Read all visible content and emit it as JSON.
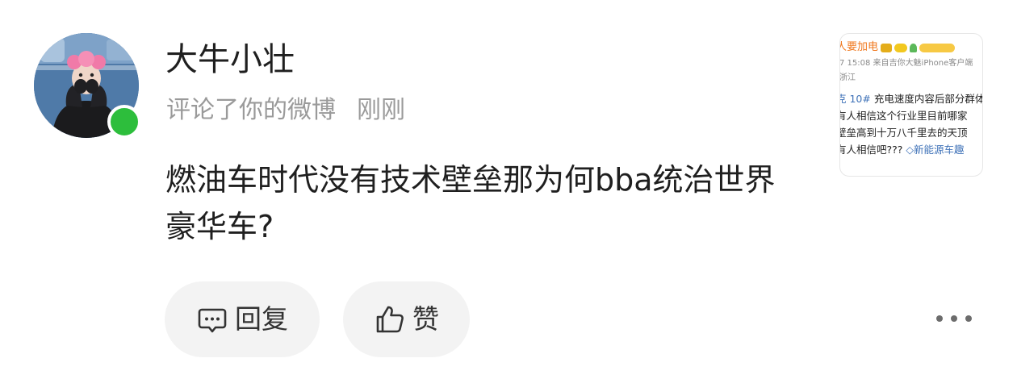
{
  "user": {
    "name": "大牛小壮",
    "action": "评论了你的微博",
    "time": "刚刚",
    "online": true,
    "avatar_icon": "user-avatar"
  },
  "comment": {
    "text": "燃油车时代没有技术壁垒那为何bba统治世界豪华车?"
  },
  "actions": {
    "reply_label": "回复",
    "reply_icon": "comment-bubble-icon",
    "like_label": "赞",
    "like_icon": "thumbs-up-icon",
    "more_icon": "more-dots-icon"
  },
  "quoted_post": {
    "author": "人要加电",
    "meta": "7 15:08 来自吉你大魅iPhone客户端",
    "location": "浙江",
    "lines": [
      {
        "tag": "克 10#",
        "text": " 充电速度内容后部分群体"
      },
      {
        "tag": "",
        "text": "有人相信这个行业里目前哪家"
      },
      {
        "tag": "",
        "text": "壁垒高到十万八千里去的天顶"
      },
      {
        "tag": "",
        "text": "有人相信吧???",
        "link": "新能源车趣"
      }
    ]
  },
  "colors": {
    "online": "#2dbe3c",
    "button_bg": "#f3f3f3",
    "secondary_text": "#9a9a9a",
    "link": "#3f72b8",
    "author": "#f0781e"
  }
}
